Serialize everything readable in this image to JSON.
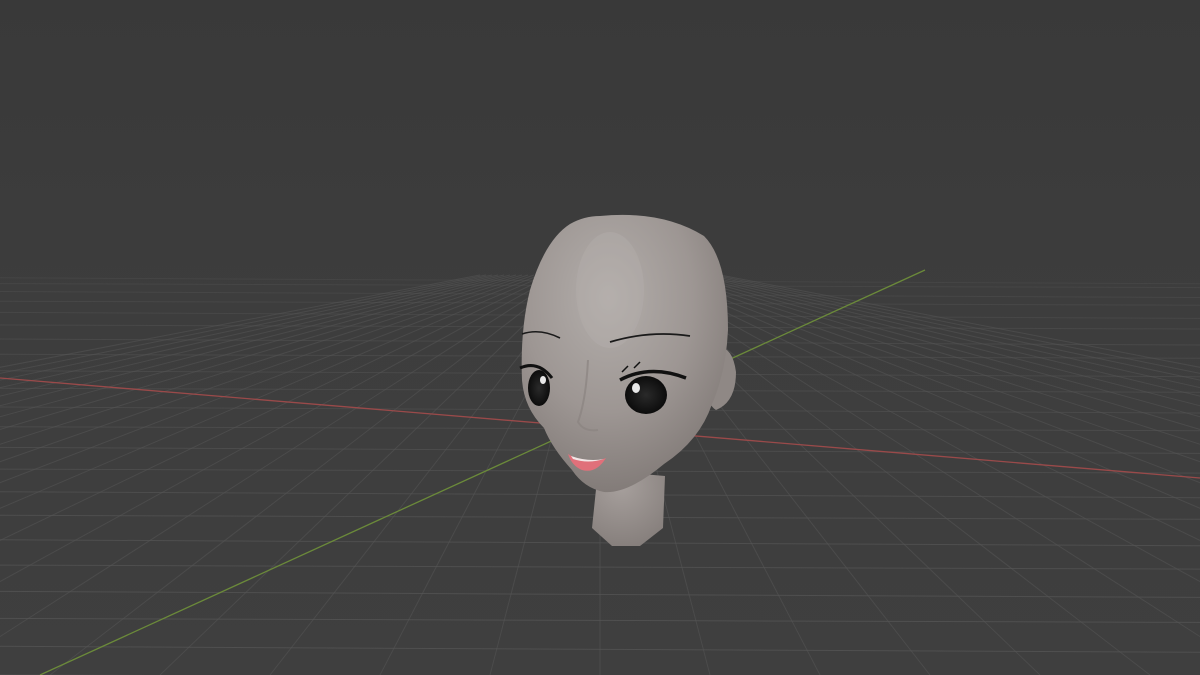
{
  "app": {
    "view": "3d-viewport"
  },
  "viewport": {
    "background_color": "#3d3d3d",
    "grid_color": "#555555",
    "x_axis_color": "#9a4a4a",
    "y_axis_color": "#6b8a3a"
  },
  "scene_object": {
    "type": "head-mesh",
    "skin_color": "#9c9592",
    "eye_color": "#111111",
    "lip_color": "#e0707a"
  }
}
